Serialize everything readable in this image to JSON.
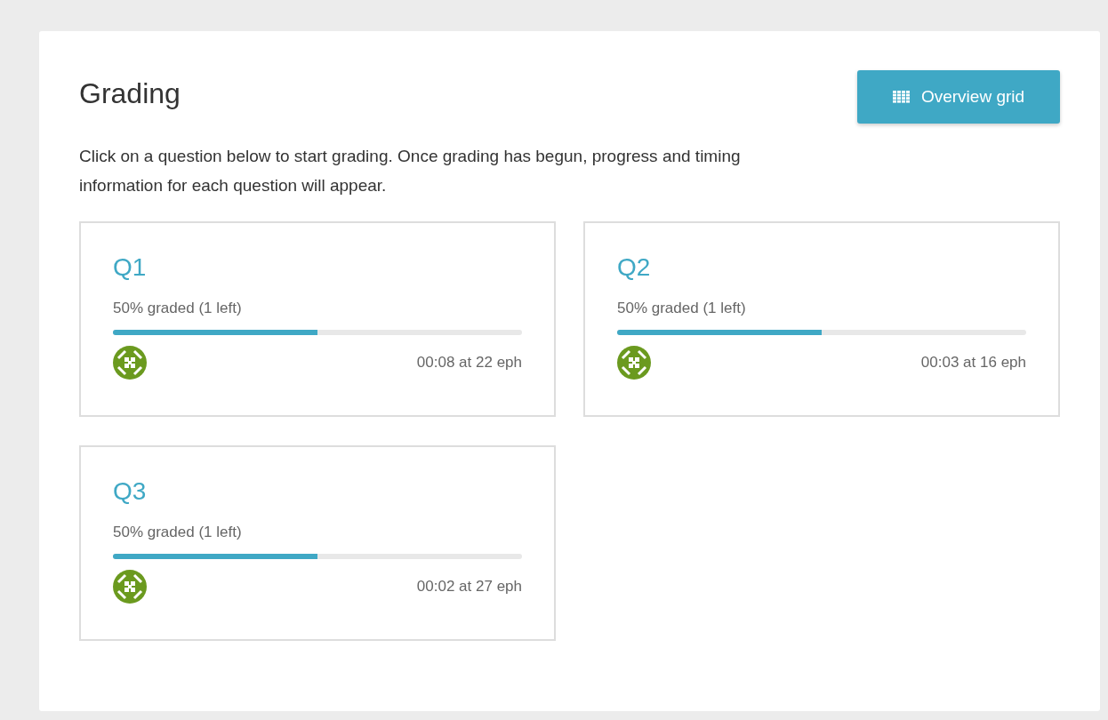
{
  "header": {
    "title": "Grading",
    "button": "Overview grid"
  },
  "intro": "Click on a question below to start grading. Once grading has begun, progress and timing information for each question will appear.",
  "questions": [
    {
      "label": "Q1",
      "progress": "50% graded (1 left)",
      "level": 0.5,
      "timing": "00:08 at 22 eph"
    },
    {
      "label": "Q2",
      "progress": "50% graded (1 left)",
      "level": 0.5,
      "timing": "00:03 at 16 eph"
    },
    {
      "label": "Q3",
      "progress": "50% graded (1 left)",
      "level": 0.5,
      "timing": "00:02 at 27 eph"
    }
  ]
}
